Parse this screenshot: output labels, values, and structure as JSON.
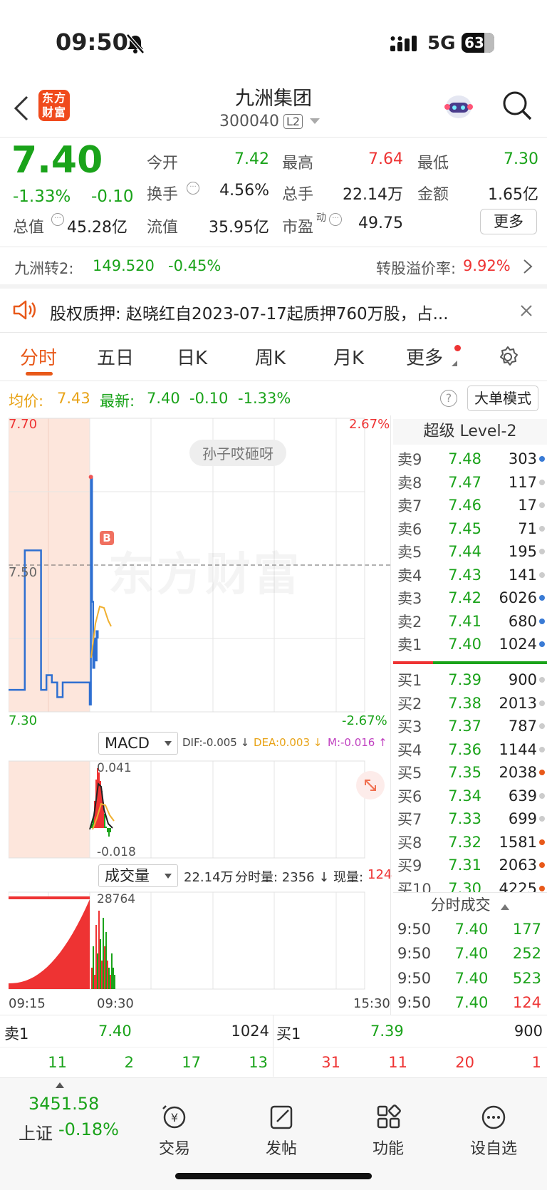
{
  "status_bar": {
    "time": "09:50",
    "network": "5G",
    "battery": "63"
  },
  "header": {
    "title": "九洲集团",
    "code": "300040",
    "level_badge": "L2",
    "logo_text": "东方财富"
  },
  "quote": {
    "price": "7.40",
    "change_pct": "-1.33%",
    "change": "-0.10",
    "open_label": "今开",
    "open": "7.42",
    "high_label": "最高",
    "high": "7.64",
    "low_label": "最低",
    "low": "7.30",
    "turnover_label": "换手",
    "turnover": "4.56%",
    "volume_label": "总手",
    "volume": "22.14万",
    "amount_label": "金额",
    "amount": "1.65亿",
    "mktcap_label": "总值",
    "mktcap": "45.28亿",
    "float_label": "流值",
    "float": "35.95亿",
    "pe_label": "市盈",
    "pe_sup": "动",
    "pe": "49.75",
    "more_button": "更多"
  },
  "convertible": {
    "name": "九洲转2:",
    "price": "149.520",
    "change": "-0.45%",
    "premium_label": "转股溢价率:",
    "premium": "9.92%"
  },
  "notice": {
    "text": "股权质押:  赵晓红自2023-07-17起质押760万股，占..."
  },
  "tabs": [
    {
      "label": "分时",
      "active": true
    },
    {
      "label": "五日"
    },
    {
      "label": "日K"
    },
    {
      "label": "周K"
    },
    {
      "label": "月K"
    },
    {
      "label": "更多"
    }
  ],
  "info_line": {
    "avg_label": "均价:",
    "avg": "7.43",
    "last_label": "最新:",
    "last": "7.40",
    "change": "-0.10",
    "change_pct": "-1.33%",
    "mode_button": "大单模式"
  },
  "chart": {
    "price_top": "7.70",
    "price_mid": "7.50",
    "price_bottom": "7.30",
    "pct_top": "2.67%",
    "pct_bottom": "-2.67%",
    "watermark": "东方财富",
    "bubble": "孙子哎砸呀",
    "b_marker": "B",
    "macd_label": "MACD",
    "dif": "DIF:-0.005 ↓",
    "dea": "DEA:0.003 ↓",
    "m": "M:-0.016 ↑",
    "macd_top": "0.041",
    "macd_bottom": "-0.018",
    "vol_label": "成交量",
    "vol_total": "22.14万",
    "vol_period": "分时量: 2356 ↓",
    "vol_now_label": "现量:",
    "vol_now": "124",
    "vol_top": "28764",
    "time_start": "09:15",
    "time_open": "09:30",
    "time_end": "15:30"
  },
  "chart_data": {
    "type": "line",
    "x": [
      "09:15",
      "09:18",
      "09:20",
      "09:21",
      "09:22",
      "09:23",
      "09:24",
      "09:25",
      "09:27",
      "09:29",
      "09:30",
      "09:31",
      "09:32",
      "09:33",
      "09:34",
      "09:35",
      "09:36",
      "09:37"
    ],
    "series": [
      {
        "values": [
          7.33,
          7.52,
          7.52,
          7.33,
          7.35,
          7.34,
          7.32,
          7.34,
          7.34,
          7.34,
          7.31,
          7.62,
          7.45,
          7.36,
          7.4,
          7.37,
          7.41,
          7.4
        ]
      }
    ],
    "ylim": [
      7.3,
      7.7
    ]
  },
  "order_book": {
    "title": "超级 Level-2",
    "asks": [
      {
        "label": "卖9",
        "price": "7.48",
        "vol": "303",
        "dot": "#3a7bd5"
      },
      {
        "label": "卖8",
        "price": "7.47",
        "vol": "117",
        "dot": "#ccc"
      },
      {
        "label": "卖7",
        "price": "7.46",
        "vol": "17",
        "dot": "#ccc"
      },
      {
        "label": "卖6",
        "price": "7.45",
        "vol": "71",
        "dot": "#ccc"
      },
      {
        "label": "卖5",
        "price": "7.44",
        "vol": "195",
        "dot": "#ccc"
      },
      {
        "label": "卖4",
        "price": "7.43",
        "vol": "141",
        "dot": "#ccc"
      },
      {
        "label": "卖3",
        "price": "7.42",
        "vol": "6026",
        "dot": "#3a7bd5"
      },
      {
        "label": "卖2",
        "price": "7.41",
        "vol": "680",
        "dot": "#3a7bd5"
      },
      {
        "label": "卖1",
        "price": "7.40",
        "vol": "1024",
        "dot": "#3a7bd5"
      }
    ],
    "bids": [
      {
        "label": "买1",
        "price": "7.39",
        "vol": "900",
        "dot": "#ccc"
      },
      {
        "label": "买2",
        "price": "7.38",
        "vol": "2013",
        "dot": "#ccc"
      },
      {
        "label": "买3",
        "price": "7.37",
        "vol": "787",
        "dot": "#ccc"
      },
      {
        "label": "买4",
        "price": "7.36",
        "vol": "1144",
        "dot": "#ccc"
      },
      {
        "label": "买5",
        "price": "7.35",
        "vol": "2038",
        "dot": "#e8591a"
      },
      {
        "label": "买6",
        "price": "7.34",
        "vol": "639",
        "dot": "#ccc"
      },
      {
        "label": "买7",
        "price": "7.33",
        "vol": "699",
        "dot": "#ccc"
      },
      {
        "label": "买8",
        "price": "7.32",
        "vol": "1581",
        "dot": "#e8591a"
      },
      {
        "label": "买9",
        "price": "7.31",
        "vol": "2063",
        "dot": "#e8591a"
      },
      {
        "label": "买10",
        "price": "7.30",
        "vol": "4225",
        "dot": "#e8591a"
      }
    ],
    "ticks_title": "分时成交",
    "ticks": [
      {
        "time": "9:50",
        "price": "7.40",
        "vol": "177",
        "color": "#1aa31a"
      },
      {
        "time": "9:50",
        "price": "7.40",
        "vol": "252",
        "color": "#1aa31a"
      },
      {
        "time": "9:50",
        "price": "7.40",
        "vol": "523",
        "color": "#1aa31a"
      },
      {
        "time": "9:50",
        "price": "7.40",
        "vol": "124",
        "color": "#e33"
      }
    ]
  },
  "bottom_quote": {
    "ask_label": "卖1",
    "ask_price": "7.40",
    "ask_vol": "1024",
    "bid_label": "买1",
    "bid_price": "7.39",
    "bid_vol": "900",
    "left_counts": [
      "11",
      "2",
      "17",
      "13"
    ],
    "right_counts": [
      "31",
      "11",
      "20",
      "1"
    ]
  },
  "bottom_nav": {
    "index_value": "3451.58",
    "index_name": "上证",
    "index_change": "-0.18%",
    "items": [
      "交易",
      "发帖",
      "功能",
      "设自选"
    ]
  }
}
